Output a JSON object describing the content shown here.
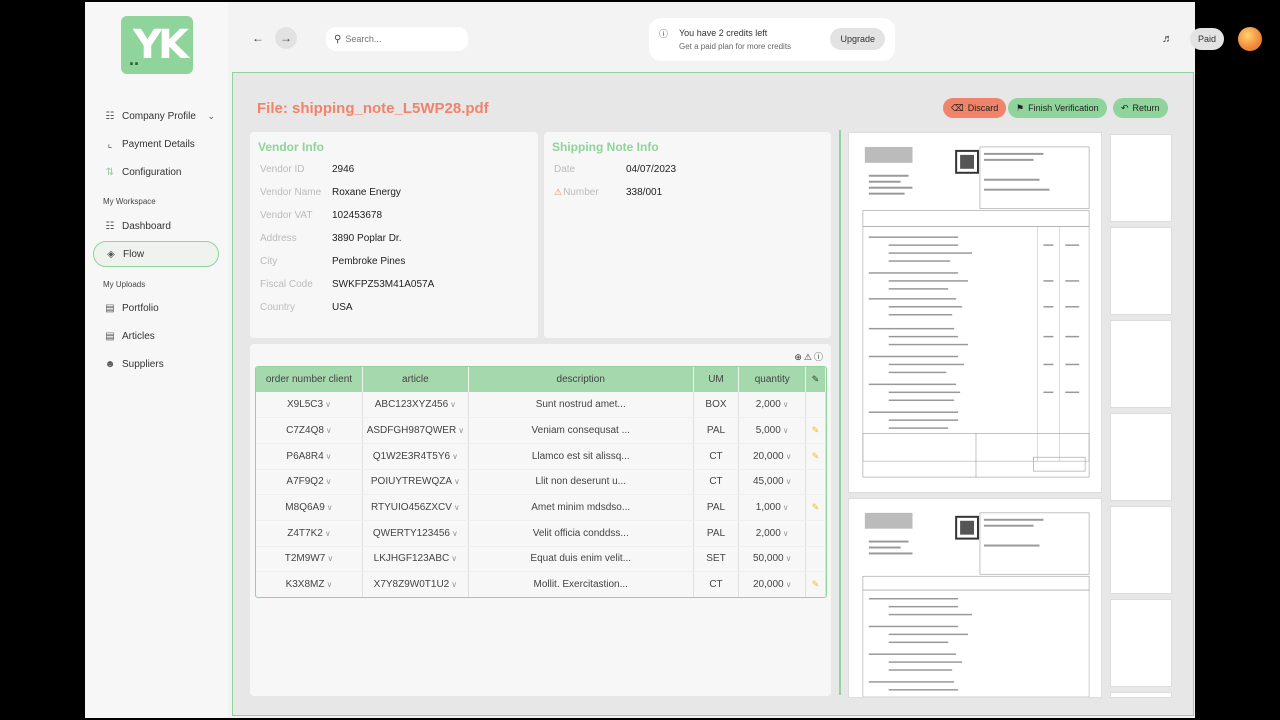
{
  "sidebar": {
    "items": [
      {
        "label": "Company Profile",
        "icon": "sitemap-icon",
        "chevron": true
      },
      {
        "label": "Payment Details",
        "icon": "phone-icon"
      },
      {
        "label": "Configuration",
        "icon": "sliders-icon"
      }
    ],
    "workspace_label": "My Workspace",
    "workspace_items": [
      {
        "label": "Dashboard",
        "icon": "hierarchy-icon"
      },
      {
        "label": "Flow",
        "icon": "flow-icon",
        "active": true
      }
    ],
    "uploads_label": "My Uploads",
    "upload_items": [
      {
        "label": "Portfolio",
        "icon": "folder-icon"
      },
      {
        "label": "Articles",
        "icon": "document-icon"
      },
      {
        "label": "Suppliers",
        "icon": "users-icon"
      }
    ]
  },
  "topbar": {
    "search_placeholder": "Search...",
    "credits_line1": "You have 2 credits left",
    "credits_line2": "Get a paid plan for more credits",
    "upgrade_label": "Upgrade",
    "paid_label": "Paid"
  },
  "main": {
    "file_title": "File: shipping_note_L5WP28.pdf",
    "discard_label": "Discard",
    "finish_label": "Finish Verification",
    "return_label": "Return"
  },
  "vendor": {
    "title": "Vendor Info",
    "fields": [
      {
        "label": "Vendor ID",
        "value": "2946"
      },
      {
        "label": "Vendor Name",
        "value": "Roxane Energy"
      },
      {
        "label": "Vendor VAT",
        "value": "102453678"
      },
      {
        "label": "Address",
        "value": "3890 Poplar Dr."
      },
      {
        "label": "City",
        "value": "Pembroke Pines"
      },
      {
        "label": "Fiscal Code",
        "value": "SWKFPZ53M41A057A"
      },
      {
        "label": "Country",
        "value": "USA"
      }
    ]
  },
  "shipping": {
    "title": "Shipping Note Info",
    "fields": [
      {
        "label": "Date",
        "value": "04/07/2023"
      },
      {
        "label": "Number",
        "value": "338/001",
        "warning": true
      }
    ]
  },
  "table": {
    "columns": [
      "order number client",
      "article",
      "description",
      "UM",
      "quantity"
    ],
    "rows": [
      {
        "order": "X9L5C3",
        "article": "ABC123XYZ456",
        "description": "Sunt nostrud amet...",
        "um": "BOX",
        "quantity": "2,000",
        "edit": false
      },
      {
        "order": "C7Z4Q8",
        "article": "ASDFGH987QWER",
        "description": "Veniam consequsat ...",
        "um": "PAL",
        "quantity": "5,000",
        "edit": true
      },
      {
        "order": "P6A8R4",
        "article": "Q1W2E3R4T5Y6",
        "description": "Llamco est sit alissq...",
        "um": "CT",
        "quantity": "20,000",
        "edit": true
      },
      {
        "order": "A7F9Q2",
        "article": "POIUYTREWQZA",
        "description": "Llit non deserunt u...",
        "um": "CT",
        "quantity": "45,000",
        "edit": false
      },
      {
        "order": "M8Q6A9",
        "article": "RTYUIO456ZXCV",
        "description": "Amet minim mdsdso...",
        "um": "PAL",
        "quantity": "1,000",
        "edit": true
      },
      {
        "order": "Z4T7K2",
        "article": "QWERTY123456",
        "description": "Velit officia conddss...",
        "um": "PAL",
        "quantity": "2,000",
        "edit": false
      },
      {
        "order": "T2M9W7",
        "article": "LKJHGF123ABC",
        "description": "Equat duis enim velit...",
        "um": "SET",
        "quantity": "50,000",
        "edit": false
      },
      {
        "order": "K3X8MZ",
        "article": "X7Y8Z9W0T1U2",
        "description": "Mollit. Exercitastion...",
        "um": "CT",
        "quantity": "20,000",
        "edit": true
      }
    ]
  },
  "colors": {
    "accent_green": "#8fd49a",
    "accent_red": "#f0836a",
    "edit_yellow": "#e8c020"
  }
}
